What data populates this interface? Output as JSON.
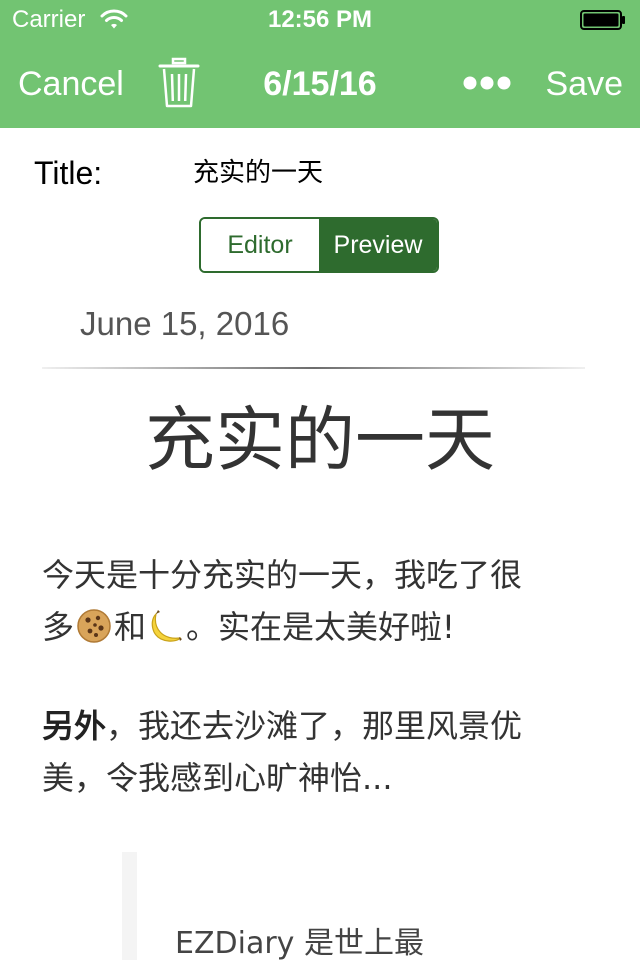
{
  "status_bar": {
    "carrier": "Carrier",
    "time": "12:56 PM"
  },
  "nav_bar": {
    "cancel_label": "Cancel",
    "title": "6/15/16",
    "save_label": "Save"
  },
  "title_row": {
    "label": "Title:",
    "value": "充实的一天"
  },
  "segmented_control": {
    "options": [
      "Editor",
      "Preview"
    ],
    "selected": "Preview"
  },
  "preview": {
    "date": "June 15, 2016",
    "heading": "充实的一天",
    "paragraph1": {
      "line1": "今天是十分充实的一天，我吃了很",
      "line2_start": "多",
      "emoji1": "cookie",
      "line2_mid": "和",
      "emoji2": "banana",
      "line2_end": "。实在是太美好啦!"
    },
    "paragraph2": {
      "bold": "另外",
      "rest_line1": "，我还去沙滩了，那里风景优",
      "line2": "美，令我感到心旷神怡..."
    },
    "blockquote_text": "EZDiary 是世上最"
  },
  "colors": {
    "nav_green": "#72c472",
    "accent_dark_green": "#2e6b2e",
    "text_gray": "#333333"
  },
  "icons": [
    "wifi-icon",
    "battery-icon",
    "trash-icon",
    "more-icon"
  ]
}
